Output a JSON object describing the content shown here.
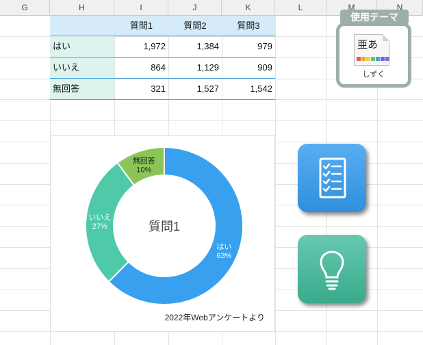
{
  "columns": [
    "G",
    "H",
    "I",
    "J",
    "K",
    "L",
    "M",
    "N"
  ],
  "table": {
    "headers": [
      "",
      "質問1",
      "質問2",
      "質問3"
    ],
    "rows": [
      {
        "label": "はい",
        "values": [
          "1,972",
          "1,384",
          "979"
        ]
      },
      {
        "label": "いいえ",
        "values": [
          "864",
          "1,129",
          "909"
        ]
      },
      {
        "label": "無回答",
        "values": [
          "321",
          "1,527",
          "1,542"
        ]
      }
    ]
  },
  "chart_data": {
    "type": "pie",
    "variant": "donut",
    "title": "質問1",
    "source": "2022年Webアンケートより",
    "categories": [
      "はい",
      "いいえ",
      "無回答"
    ],
    "values": [
      1972,
      864,
      321
    ],
    "percent_labels": [
      "63%",
      "27%",
      "10%"
    ],
    "colors": [
      "#38a0ee",
      "#4ecaa9",
      "#8bc558"
    ],
    "legend": "none"
  },
  "theme": {
    "title": "使用テーマ",
    "name": "しずく",
    "glyph": "亜あ",
    "swatches": [
      "#e15b5b",
      "#f0a33b",
      "#e7d44a",
      "#6cc065",
      "#4aa3df",
      "#5b6fd8",
      "#9a62c8"
    ]
  },
  "buttons": {
    "checklist_icon": "checklist-icon",
    "idea_icon": "lightbulb-icon"
  }
}
